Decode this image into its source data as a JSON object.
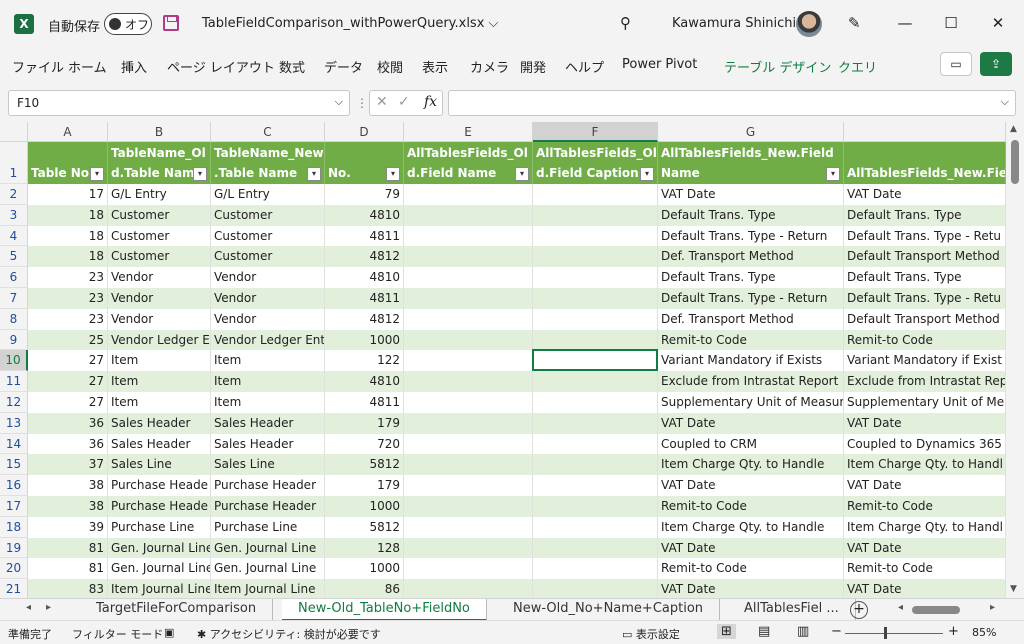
{
  "titlebar": {
    "app_icon": "X",
    "autosave_label": "自動保存",
    "autosave_state": "オフ",
    "doc_title": "TableFieldComparison_withPowerQuery.xlsx",
    "doc_title_chevron": "⌵",
    "user_name": "Kawamura Shinichi",
    "search_glyph": "⚲",
    "pen_glyph": "✎",
    "minimize_glyph": "—",
    "maximize_glyph": "☐",
    "close_glyph": "✕"
  },
  "ribbon": {
    "tabs": [
      "ファイル",
      "ホーム",
      "挿入",
      "ページ レイアウト",
      "数式",
      "データ",
      "校閲",
      "表示",
      "カメラ",
      "開発",
      "ヘルプ",
      "Power Pivot",
      "テーブル デザイン",
      "クエリ"
    ],
    "comment_glyph": "▭",
    "share_glyph": "⇪"
  },
  "formula_bar": {
    "name_box": "F10",
    "cancel_glyph": "✕",
    "enter_glyph": "✓",
    "fx_label": "fx",
    "formula_value": ""
  },
  "grid": {
    "column_letters": [
      "A",
      "B",
      "C",
      "D",
      "E",
      "F",
      "G"
    ],
    "header_row_number": "1",
    "headers": [
      "Table No.",
      "TableName_Old.Table Name",
      "TableName_New.Table Name",
      "No.",
      "AllTablesFields_Old.Field Name",
      "AllTablesFields_Old.Field Caption",
      "AllTablesFields_New.Field Name",
      "AllTablesFields_New.Field Caption"
    ],
    "header_lines": [
      [
        "",
        "Table No."
      ],
      [
        "TableName_Ol",
        "d.Table Name"
      ],
      [
        "TableName_New",
        ".Table Name"
      ],
      [
        "",
        "No."
      ],
      [
        "AllTablesFields_Ol",
        "d.Field Name"
      ],
      [
        "AllTablesFields_Ol",
        "d.Field Caption"
      ],
      [
        "AllTablesFields_New.Field",
        "Name"
      ],
      [
        "",
        "AllTablesFields_New.Fie"
      ]
    ],
    "rows": [
      {
        "num": "2",
        "cells": [
          "17",
          "G/L Entry",
          "G/L Entry",
          "79",
          "",
          "",
          "VAT Date",
          "VAT Date"
        ]
      },
      {
        "num": "3",
        "cells": [
          "18",
          "Customer",
          "Customer",
          "4810",
          "",
          "",
          "Default Trans. Type",
          "Default Trans. Type"
        ]
      },
      {
        "num": "4",
        "cells": [
          "18",
          "Customer",
          "Customer",
          "4811",
          "",
          "",
          "Default Trans. Type - Return",
          "Default Trans. Type - Retu"
        ]
      },
      {
        "num": "5",
        "cells": [
          "18",
          "Customer",
          "Customer",
          "4812",
          "",
          "",
          "Def. Transport Method",
          "Default Transport Method"
        ]
      },
      {
        "num": "6",
        "cells": [
          "23",
          "Vendor",
          "Vendor",
          "4810",
          "",
          "",
          "Default Trans. Type",
          "Default Trans. Type"
        ]
      },
      {
        "num": "7",
        "cells": [
          "23",
          "Vendor",
          "Vendor",
          "4811",
          "",
          "",
          "Default Trans. Type - Return",
          "Default Trans. Type - Retu"
        ]
      },
      {
        "num": "8",
        "cells": [
          "23",
          "Vendor",
          "Vendor",
          "4812",
          "",
          "",
          "Def. Transport Method",
          "Default Transport Method"
        ]
      },
      {
        "num": "9",
        "cells": [
          "25",
          "Vendor Ledger E",
          "Vendor Ledger Ent",
          "1000",
          "",
          "",
          "Remit-to Code",
          "Remit-to Code"
        ]
      },
      {
        "num": "10",
        "cells": [
          "27",
          "Item",
          "Item",
          "122",
          "",
          "",
          "Variant Mandatory if Exists",
          "Variant Mandatory if Exist"
        ]
      },
      {
        "num": "11",
        "cells": [
          "27",
          "Item",
          "Item",
          "4810",
          "",
          "",
          "Exclude from Intrastat Report",
          "Exclude from Intrastat Rep"
        ]
      },
      {
        "num": "12",
        "cells": [
          "27",
          "Item",
          "Item",
          "4811",
          "",
          "",
          "Supplementary Unit of Measur",
          "Supplementary Unit of Me"
        ]
      },
      {
        "num": "13",
        "cells": [
          "36",
          "Sales Header",
          "Sales Header",
          "179",
          "",
          "",
          "VAT Date",
          "VAT Date"
        ]
      },
      {
        "num": "14",
        "cells": [
          "36",
          "Sales Header",
          "Sales Header",
          "720",
          "",
          "",
          "Coupled to CRM",
          "Coupled to Dynamics 365"
        ]
      },
      {
        "num": "15",
        "cells": [
          "37",
          "Sales Line",
          "Sales Line",
          "5812",
          "",
          "",
          "Item Charge Qty. to Handle",
          "Item Charge Qty. to Handl"
        ]
      },
      {
        "num": "16",
        "cells": [
          "38",
          "Purchase Heade",
          "Purchase Header",
          "179",
          "",
          "",
          "VAT Date",
          "VAT Date"
        ]
      },
      {
        "num": "17",
        "cells": [
          "38",
          "Purchase Heade",
          "Purchase Header",
          "1000",
          "",
          "",
          "Remit-to Code",
          "Remit-to Code"
        ]
      },
      {
        "num": "18",
        "cells": [
          "39",
          "Purchase Line",
          "Purchase Line",
          "5812",
          "",
          "",
          "Item Charge Qty. to Handle",
          "Item Charge Qty. to Handl"
        ]
      },
      {
        "num": "19",
        "cells": [
          "81",
          "Gen. Journal Line",
          "Gen. Journal Line",
          "128",
          "",
          "",
          "VAT Date",
          "VAT Date"
        ]
      },
      {
        "num": "20",
        "cells": [
          "81",
          "Gen. Journal Line",
          "Gen. Journal Line",
          "1000",
          "",
          "",
          "Remit-to Code",
          "Remit-to Code"
        ]
      },
      {
        "num": "21",
        "cells": [
          "83",
          "Item Journal Line",
          "Item Journal Line",
          "86",
          "",
          "",
          "VAT Date",
          "VAT Date"
        ]
      }
    ],
    "selected_cell": "F10",
    "header_color": "#70ad47",
    "band_color": "#e2efda",
    "accent_color": "#107c41"
  },
  "sheets": {
    "tabs": [
      "TargetFileForComparison",
      "New-Old_TableNo+FieldNo",
      "New-Old_No+Name+Caption",
      "AllTablesFiel ..."
    ],
    "active_index": 1,
    "add_glyph": "+",
    "prev_glyph": "◂",
    "next_glyph": "▸"
  },
  "statusbar": {
    "ready": "準備完了",
    "filter_mode": "フィルター モード",
    "accessibility": "アクセシビリティ: 検討が必要です",
    "display_settings": "表示設定",
    "zoom": "85%",
    "zoom_minus": "−",
    "zoom_plus": "+"
  }
}
